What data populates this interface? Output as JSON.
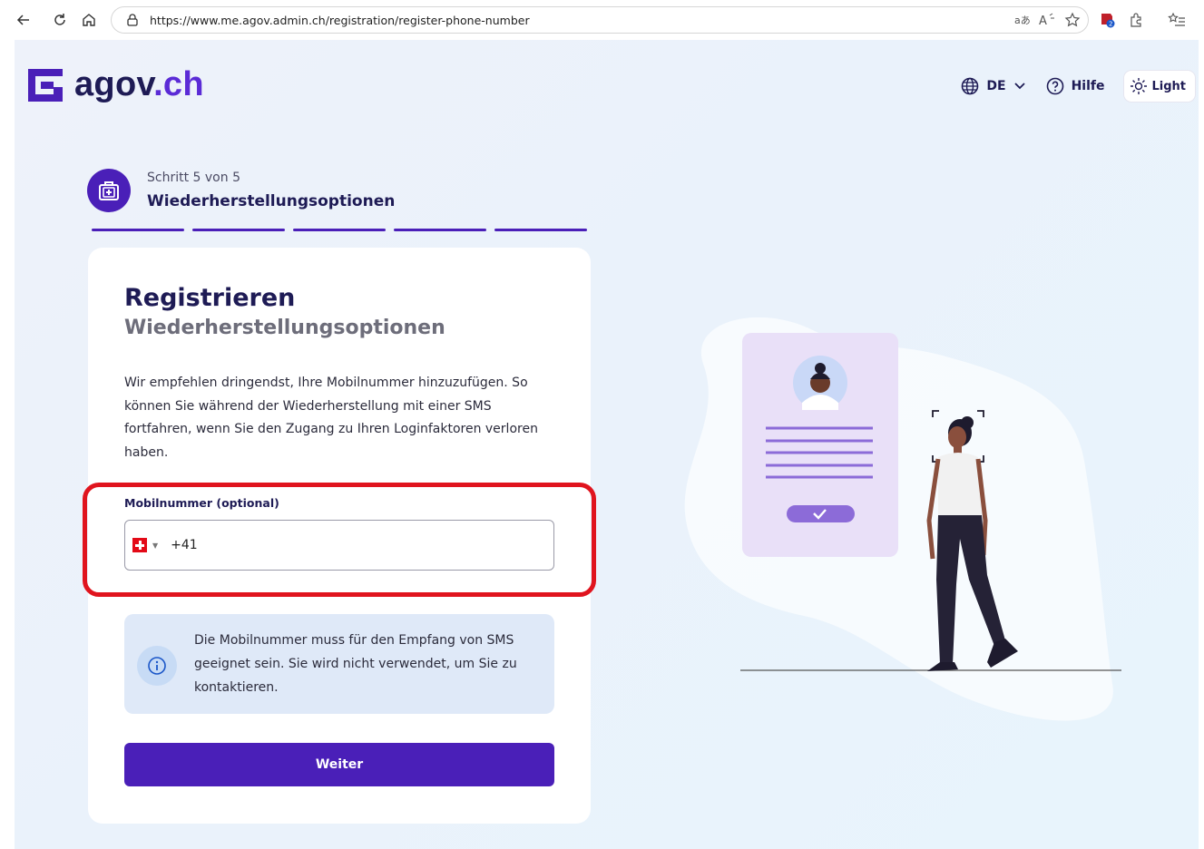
{
  "browser": {
    "url": "https://www.me.agov.admin.ch/registration/register-phone-number"
  },
  "header": {
    "logo_text": "agov",
    "logo_suffix": ".ch",
    "language": "DE",
    "help": "Hilfe",
    "theme": "Light"
  },
  "stepper": {
    "count": "Schritt 5 von 5",
    "title": "Wiederherstellungsoptionen",
    "total_steps": 5,
    "completed_steps": 5
  },
  "form": {
    "title": "Registrieren",
    "subtitle": "Wiederherstellungsoptionen",
    "intro": "Wir empfehlen dringendst, Ihre Mobilnummer hinzuzufügen. So können Sie während der Wiederherstellung mit einer SMS fortfahren, wenn Sie den Zugang zu Ihren Loginfaktoren verloren haben.",
    "phone_label": "Mobilnummer (optional)",
    "phone_value": "+41",
    "info": "Die Mobilnummer muss für den Empfang von SMS geeignet sein. Sie wird nicht verwendet, um Sie zu kontaktieren.",
    "submit": "Weiter"
  },
  "colors": {
    "primary": "#4a1fb8",
    "navy": "#1e1b55",
    "highlight": "#e0141e",
    "info_bg": "#dfe9f8"
  }
}
